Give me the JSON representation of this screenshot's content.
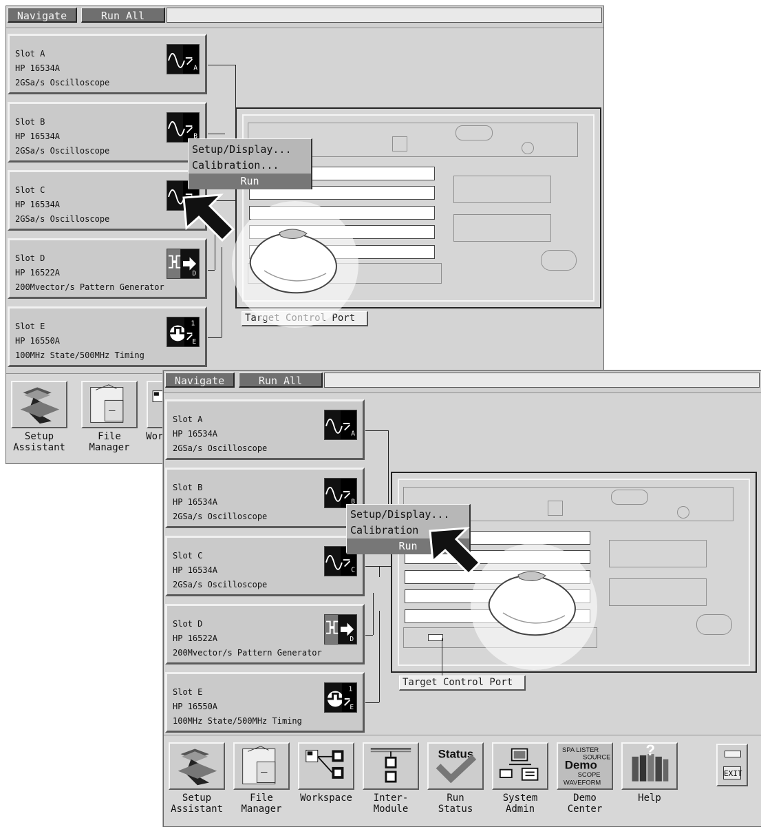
{
  "colors": {
    "window_bg": "#d4d4d4",
    "button_dark": "#6f6f6f",
    "menu_highlight": "#777777",
    "white": "#ffffff",
    "black": "#111111"
  },
  "back_screen": {
    "topbar": {
      "navigate_label": "Navigate",
      "run_all_label": "Run All"
    },
    "slots": [
      {
        "name": "Slot A",
        "model": "HP 16534A",
        "desc": "2GSa/s Oscilloscope",
        "icon": "oscilloscope-a-icon"
      },
      {
        "name": "Slot B",
        "model": "HP 16534A",
        "desc": "2GSa/s Oscilloscope",
        "icon": "oscilloscope-b-icon"
      },
      {
        "name": "Slot C",
        "model": "HP 16534A",
        "desc": "2GSa/s Oscilloscope",
        "icon": "oscilloscope-c-icon"
      },
      {
        "name": "Slot D",
        "model": "HP 16522A",
        "desc": "200Mvector/s Pattern Generator",
        "icon": "pattern-generator-d-icon"
      },
      {
        "name": "Slot E",
        "model": "HP 16550A",
        "desc": "100MHz State/500MHz Timing",
        "icon": "timing-e-icon"
      }
    ],
    "menu": {
      "setup_display": "Setup/Display...",
      "calibration": "Calibration...",
      "run": "Run"
    },
    "target_port_label": "Target Control Port",
    "toolbar": {
      "setup_assistant": "Setup\nAssistant",
      "file_manager": "File\nManager",
      "workspace_partial": "Work"
    }
  },
  "front_screen": {
    "topbar": {
      "navigate_label": "Navigate",
      "run_all_label": "Run All"
    },
    "slots": [
      {
        "name": "Slot A",
        "model": "HP 16534A",
        "desc": "2GSa/s Oscilloscope",
        "icon": "oscilloscope-a-icon"
      },
      {
        "name": "Slot B",
        "model": "HP 16534A",
        "desc": "2GSa/s Oscilloscope",
        "icon": "oscilloscope-b-icon"
      },
      {
        "name": "Slot C",
        "model": "HP 16534A",
        "desc": "2GSa/s Oscilloscope",
        "icon": "oscilloscope-c-icon"
      },
      {
        "name": "Slot D",
        "model": "HP 16522A",
        "desc": "200Mvector/s Pattern Generator",
        "icon": "pattern-generator-d-icon"
      },
      {
        "name": "Slot E",
        "model": "HP 16550A",
        "desc": "100MHz State/500MHz Timing",
        "icon": "timing-e-icon"
      }
    ],
    "menu": {
      "setup_display": "Setup/Display...",
      "calibration": "Calibration",
      "run": "Run"
    },
    "target_port_label": "Target Control Port",
    "toolbar": {
      "setup_assistant": "Setup\nAssistant",
      "file_manager": "File\nManager",
      "workspace": "Workspace",
      "inter_module": "Inter-\nModule",
      "run_status": "Run\nStatus",
      "system_admin": "System\nAdmin",
      "demo_center": "Demo\nCenter",
      "help": "Help",
      "status_word": "Status",
      "demo_lines": [
        "SPA LISTER",
        "SOURCE",
        "Demo",
        "SCOPE",
        "WAVEFORM"
      ],
      "exit_label": "EXIT"
    }
  }
}
